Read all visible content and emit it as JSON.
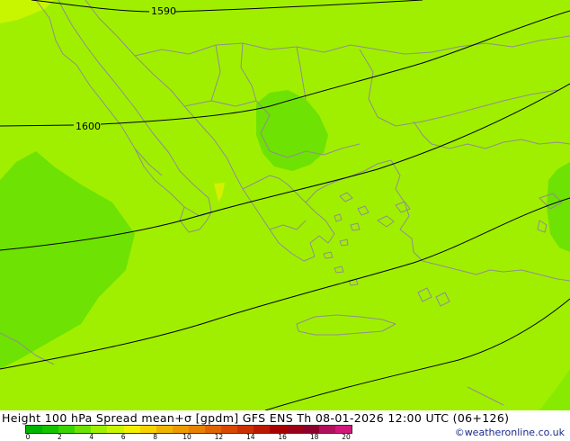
{
  "map": {
    "contour_labels": [
      "1590",
      "1600"
    ],
    "colors": {
      "field": "#a0ef00",
      "green_spread": "#6ee202",
      "mid_spread": "#88ea00",
      "yellow_spot": "#d4f000",
      "coast": "#8f8f8f",
      "contour": "#000000"
    }
  },
  "footer": {
    "title": "Height 100 hPa Spread mean+σ [gpdm] GFS ENS Th 08-01-2026 12:00 UTC (06+126)",
    "credit": "©weatheronline.co.uk"
  },
  "legend": {
    "colors": [
      "#00b400",
      "#14c200",
      "#3cd400",
      "#6ee202",
      "#a0ef00",
      "#c8f500",
      "#f0f000",
      "#f5d200",
      "#f0b400",
      "#eb9b00",
      "#e68200",
      "#e06400",
      "#d84800",
      "#cc3000",
      "#bb1800",
      "#a80000",
      "#9a0019",
      "#8c002c",
      "#b0105c",
      "#d0187a"
    ],
    "ticks": [
      "0",
      "2",
      "4",
      "6",
      "8",
      "10",
      "12",
      "14",
      "16",
      "18",
      "20"
    ]
  }
}
